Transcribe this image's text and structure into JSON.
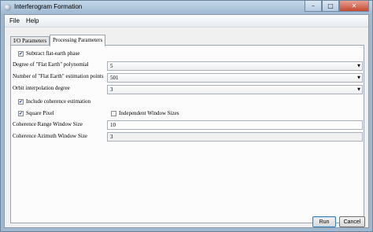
{
  "window": {
    "title": "Interferogram Formation",
    "icon": "app-icon",
    "controls": {
      "minimize": "–",
      "maximize": "□",
      "close": "✕"
    }
  },
  "menu": [
    "File",
    "Help"
  ],
  "tabs": [
    {
      "label": "I/O Parameters",
      "active": false
    },
    {
      "label": "Processing Parameters",
      "active": true
    }
  ],
  "form": {
    "subtract_flat_earth": {
      "label": "Subtract flat-earth phase",
      "checked": true
    },
    "degree_label": "Degree of \"Flat Earth\" polynomial",
    "degree_value": "5",
    "npoints_label": "Number of \"Flat Earth\" estimation points",
    "npoints_value": "501",
    "orbit_label": "Orbit interpolation degree",
    "orbit_value": "3",
    "include_coherence": {
      "label": "Include coherence estimation",
      "checked": true
    },
    "square_pixel": {
      "label": "Square Pixel",
      "checked": true
    },
    "independent_window": {
      "label": "Independent Window Sizes",
      "checked": false
    },
    "range_label": "Coherence Range Window Size",
    "range_value": "10",
    "azimuth_label": "Coherence Azimuth Window Size",
    "azimuth_value": "3"
  },
  "buttons": {
    "run": "Run",
    "cancel": "Cancel"
  }
}
